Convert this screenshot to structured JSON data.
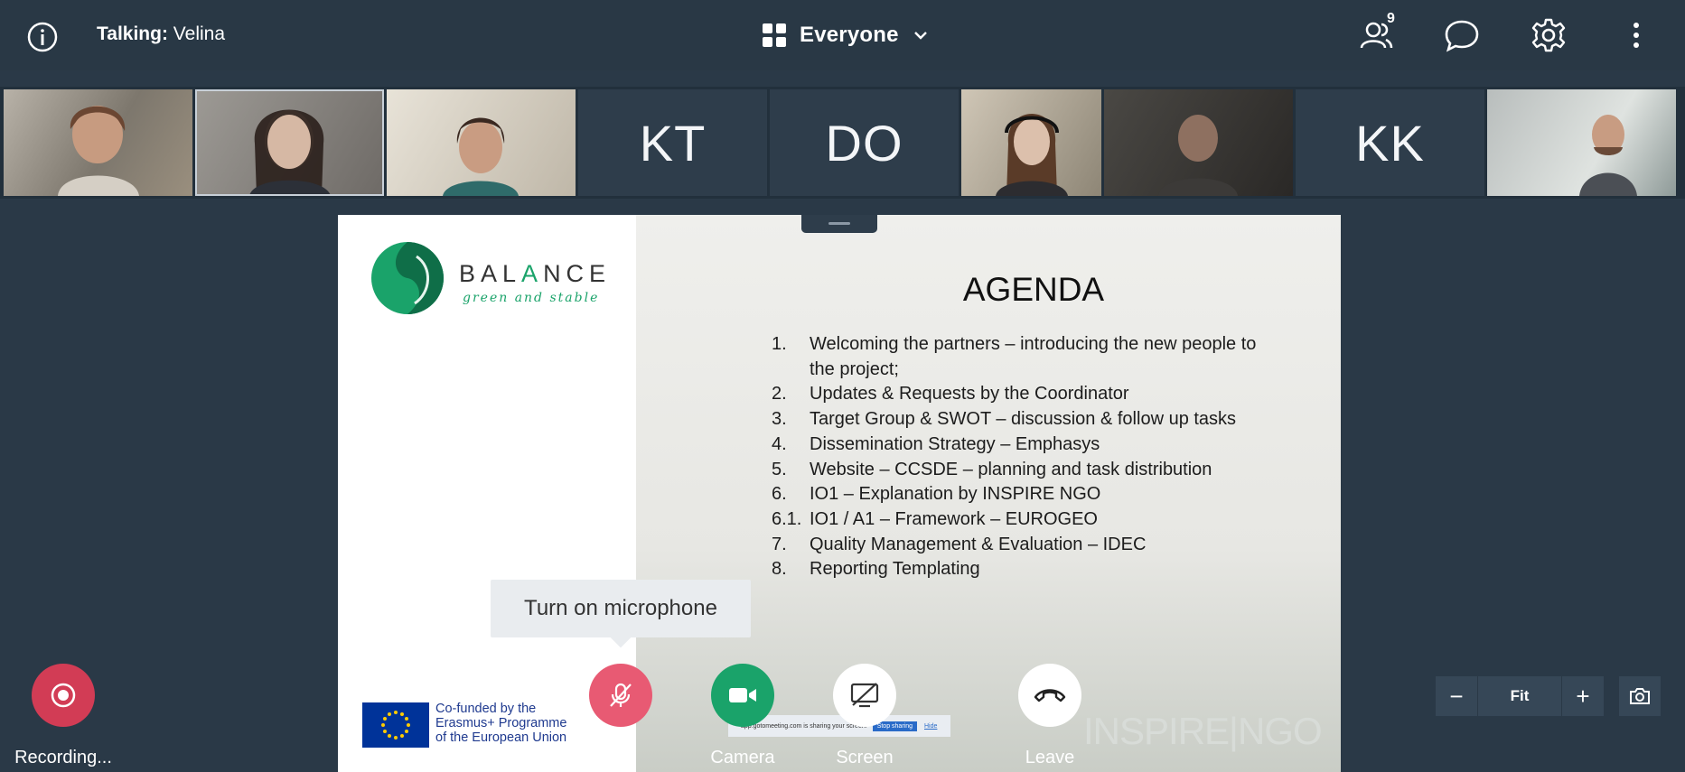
{
  "header": {
    "talking_label": "Talking:",
    "talking_name": "Velina",
    "view_label": "Everyone",
    "participant_count": "9"
  },
  "participants": [
    {
      "type": "video",
      "name": "participant-1"
    },
    {
      "type": "video",
      "name": "participant-2"
    },
    {
      "type": "video",
      "name": "participant-3"
    },
    {
      "type": "initials",
      "initials": "KT"
    },
    {
      "type": "initials",
      "initials": "DO"
    },
    {
      "type": "video",
      "name": "participant-6"
    },
    {
      "type": "video",
      "name": "participant-7"
    },
    {
      "type": "initials",
      "initials": "KK"
    },
    {
      "type": "video",
      "name": "participant-9"
    }
  ],
  "slide": {
    "logo_text_1": "BAL",
    "logo_text_a": "A",
    "logo_text_2": "NCE",
    "logo_subtitle": "green and stable",
    "title": "AGENDA",
    "agenda": [
      {
        "num": "1.",
        "text": "Welcoming the partners – introducing the new people to the project;"
      },
      {
        "num": "2.",
        "text": "Updates & Requests by the Coordinator"
      },
      {
        "num": "3.",
        "text": "Target Group & SWOT – discussion & follow up tasks"
      },
      {
        "num": "4.",
        "text": "Dissemination Strategy – Emphasys"
      },
      {
        "num": "5.",
        "text": "Website – CCSDE – planning and task distribution"
      },
      {
        "num": "6.",
        "text": "IO1 – Explanation by INSPIRE NGO"
      },
      {
        "num": "6.1.",
        "text": "IO1 / A1 – Framework – EUROGEO"
      },
      {
        "num": "7.",
        "text": "Quality Management & Evaluation – IDEC"
      },
      {
        "num": "8.",
        "text": "Reporting Templating"
      }
    ],
    "eu_line1": "Co-funded by the",
    "eu_line2": "Erasmus+ Programme",
    "eu_line3": "of the European Union",
    "inspire_logo": "INSPIRE|NGO"
  },
  "sharing_bar": {
    "text": "app.gotomeeting.com is sharing your screen.",
    "stop": "Stop sharing",
    "hide": "Hide"
  },
  "tooltip": "Turn on microphone",
  "controls": {
    "recording": "Recording...",
    "mic": "Mic",
    "camera": "Camera",
    "screen": "Screen",
    "leave": "Leave"
  },
  "zoom": {
    "minus": "−",
    "fit": "Fit",
    "plus": "+"
  },
  "colors": {
    "background": "#2a3947",
    "recording": "#d23c55",
    "mic_off": "#e85a73",
    "camera_on": "#1aa36a",
    "brand_green": "#1aa36a"
  }
}
